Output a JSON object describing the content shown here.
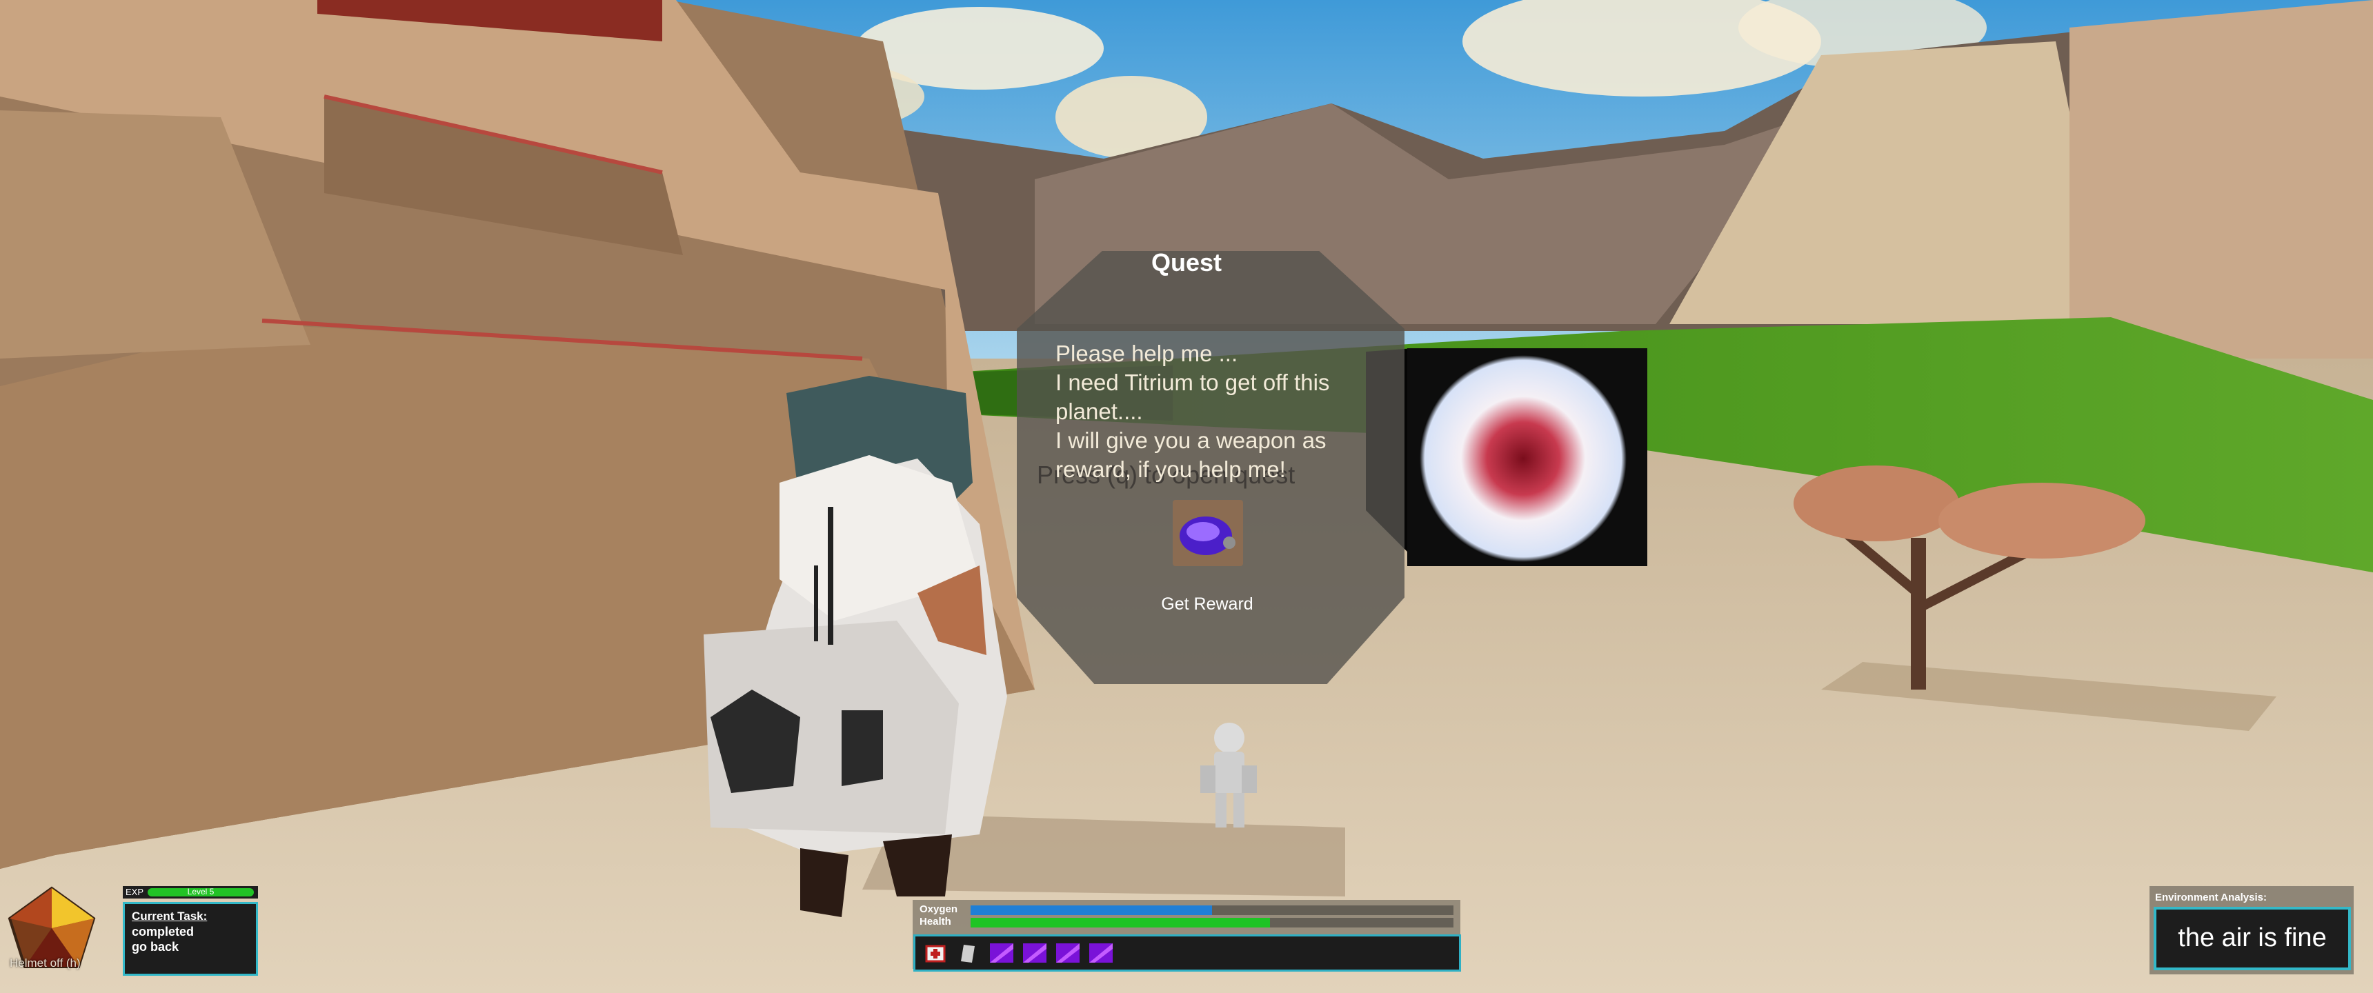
{
  "quest": {
    "title": "Quest",
    "message_lines": [
      "Please help me ...",
      "I need Titrium to get off this",
      "planet....",
      "I will give you a weapon as",
      "reward, if you help me!"
    ],
    "reward_button": "Get Reward",
    "reward_item_icon": "purple-helmet-icon"
  },
  "prompt": {
    "open_quest": "Press (q) to open quest"
  },
  "hud": {
    "helmet_label": "Helmet off (h)",
    "exp_label": "EXP",
    "level_label": "Level 5",
    "task_title": "Current Task:",
    "task_lines": [
      "completed",
      "go back"
    ],
    "oxygen_label": "Oxygen",
    "health_label": "Health",
    "oxygen_fraction": 0.5,
    "health_fraction": 0.62,
    "hotbar_items": [
      "medkit-icon",
      "canister-icon",
      "purple-crystal-icon",
      "purple-crystal-icon",
      "purple-crystal-icon",
      "purple-crystal-icon"
    ]
  },
  "environment": {
    "title": "Environment Analysis:",
    "status": "the air is fine"
  },
  "colors": {
    "accent_cyan": "#33b8c8",
    "health_green": "#1ec424",
    "oxygen_blue": "#1f7fd6",
    "quest_panel": "#55524e"
  }
}
